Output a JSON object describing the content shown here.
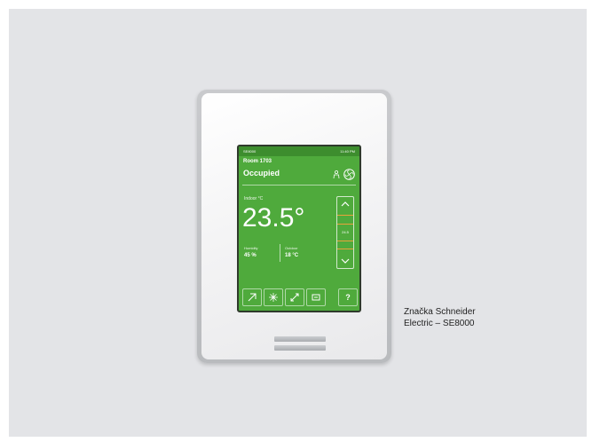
{
  "device": {
    "screen": {
      "status_date": "SE8000",
      "status_time": "11:40 PM",
      "room": "Room 1703",
      "mode": "Occupied",
      "indoor_label": "Indoor °C",
      "temperature": "23.5°",
      "setpoint": "24.5",
      "humidity_label": "Humidity",
      "humidity_value": "45 %",
      "outdoor_label": "Outdoor",
      "outdoor_value": "18 °C",
      "help_label": "?",
      "icons": [
        "occupancy-icon",
        "fan-icon",
        "mode-icon",
        "fan-speed-icon",
        "schedule-icon",
        "settings-icon",
        "help-icon"
      ],
      "colors": {
        "screen_green": "#4faa3c",
        "status_bar": "#3d8d2e",
        "setpoint_accent": "#e9a23b"
      }
    }
  },
  "caption": {
    "line1": "Značka Schneider",
    "line2": "Electric – SE8000"
  }
}
